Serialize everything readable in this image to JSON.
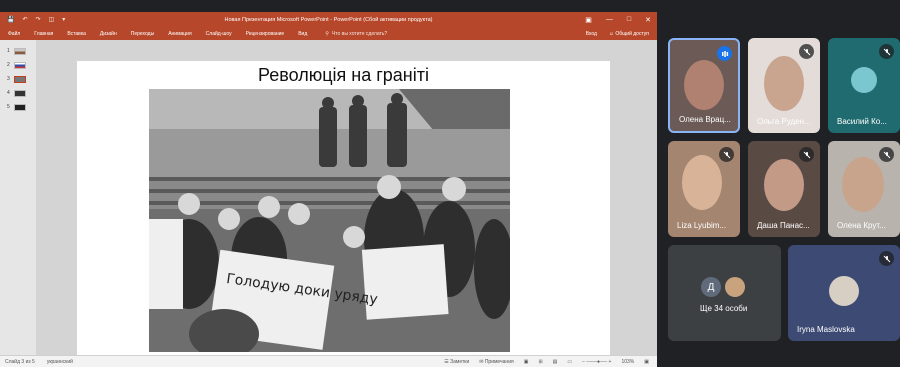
{
  "ppt": {
    "window_title": "Новая Презентация Microsoft PowerPoint - PowerPoint (Сбой активации продукта)",
    "tabs": [
      "Файл",
      "Главная",
      "Вставка",
      "Дизайн",
      "Переходы",
      "Анимация",
      "Слайд-шоу",
      "Рецензирование",
      "Вид"
    ],
    "search_placeholder": "Что вы хотите сделать?",
    "signin": "Вход",
    "share": "Общий доступ",
    "thumbnails": [
      "1",
      "2",
      "3",
      "4",
      "5"
    ],
    "active_slide_index": 3,
    "slide_title": "Революція на граніті",
    "photo_sign_text": "Голодую доки уряду",
    "status": {
      "slide_counter": "Слайд 3 из 5",
      "language": "украинский",
      "notes": "Заметки",
      "comments": "Примечания",
      "zoom": "103%"
    }
  },
  "meet": {
    "participants": [
      {
        "name": "Олена Врац...",
        "status": "speaking"
      },
      {
        "name": "Ольга Руден...",
        "status": "muted"
      },
      {
        "name": "Василий Ко...",
        "status": "muted"
      },
      {
        "name": "Liza Lyubim...",
        "status": "muted"
      },
      {
        "name": "Даша Панас...",
        "status": "muted"
      },
      {
        "name": "Олена Крут...",
        "status": "muted"
      },
      {
        "name": "Ще 34 особи",
        "status": "none"
      },
      {
        "name": "Iryna Maslovska",
        "status": "muted"
      }
    ],
    "others_initial": "Д"
  },
  "colors": {
    "ppt_accent": "#b7472a",
    "meet_bg": "#202124",
    "tile_bg": "#3c4043",
    "speaking_blue": "#1a73e8"
  }
}
